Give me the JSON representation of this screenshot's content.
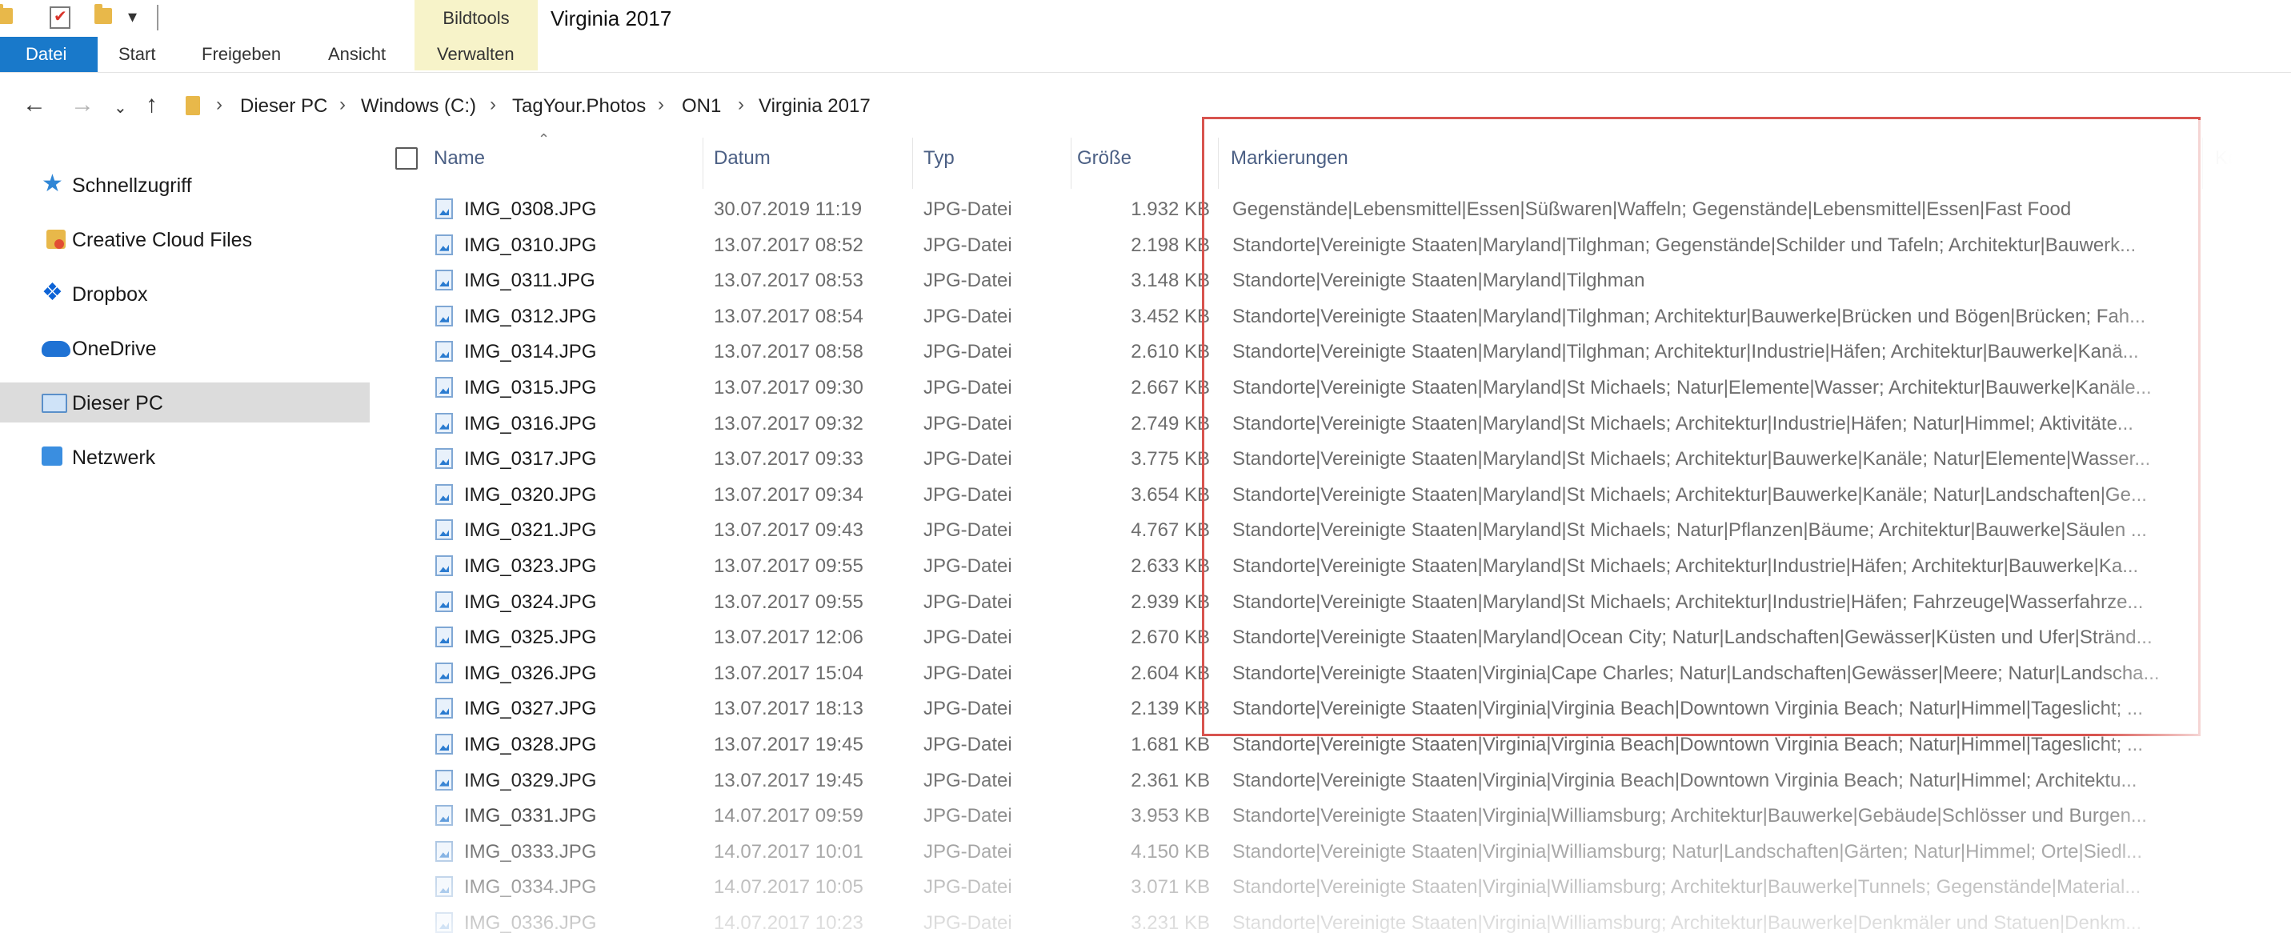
{
  "title_bar": {
    "context_tab": "Bildtools",
    "window_title": "Virginia 2017"
  },
  "ribbon": {
    "tabs": [
      "Datei",
      "Start",
      "Freigeben",
      "Ansicht",
      "Verwalten"
    ]
  },
  "address_bar": {
    "breadcrumbs": [
      "Dieser PC",
      "Windows (C:)",
      "TagYour.Photos",
      "ON1",
      "Virginia 2017"
    ]
  },
  "sidebar": {
    "items": [
      {
        "label": "Schnellzugriff",
        "icon": "star-icon"
      },
      {
        "label": "Creative Cloud Files",
        "icon": "creative-cloud-folder-icon"
      },
      {
        "label": "Dropbox",
        "icon": "dropbox-icon"
      },
      {
        "label": "OneDrive",
        "icon": "onedrive-cloud-icon"
      },
      {
        "label": "Dieser PC",
        "icon": "pc-icon",
        "selected": true
      },
      {
        "label": "Netzwerk",
        "icon": "network-icon"
      }
    ]
  },
  "columns": {
    "name": "Name",
    "date": "Datum",
    "type": "Typ",
    "size": "Größe",
    "tags": "Markierungen",
    "extra": "Kontakt"
  },
  "highlight_color": "#d8544f",
  "files": [
    {
      "name": "IMG_0308.JPG",
      "date": "30.07.2019 11:19",
      "type": "JPG-Datei",
      "size": "1.932 KB",
      "tags": "Gegenstände|Lebensmittel|Essen|Süßwaren|Waffeln; Gegenstände|Lebensmittel|Essen|Fast Food"
    },
    {
      "name": "IMG_0310.JPG",
      "date": "13.07.2017 08:52",
      "type": "JPG-Datei",
      "size": "2.198 KB",
      "tags": "Standorte|Vereinigte Staaten|Maryland|Tilghman; Gegenstände|Schilder und Tafeln; Architektur|Bauwerk..."
    },
    {
      "name": "IMG_0311.JPG",
      "date": "13.07.2017 08:53",
      "type": "JPG-Datei",
      "size": "3.148 KB",
      "tags": "Standorte|Vereinigte Staaten|Maryland|Tilghman"
    },
    {
      "name": "IMG_0312.JPG",
      "date": "13.07.2017 08:54",
      "type": "JPG-Datei",
      "size": "3.452 KB",
      "tags": "Standorte|Vereinigte Staaten|Maryland|Tilghman; Architektur|Bauwerke|Brücken und Bögen|Brücken; Fah..."
    },
    {
      "name": "IMG_0314.JPG",
      "date": "13.07.2017 08:58",
      "type": "JPG-Datei",
      "size": "2.610 KB",
      "tags": "Standorte|Vereinigte Staaten|Maryland|Tilghman; Architektur|Industrie|Häfen; Architektur|Bauwerke|Kanä..."
    },
    {
      "name": "IMG_0315.JPG",
      "date": "13.07.2017 09:30",
      "type": "JPG-Datei",
      "size": "2.667 KB",
      "tags": "Standorte|Vereinigte Staaten|Maryland|St Michaels; Natur|Elemente|Wasser; Architektur|Bauwerke|Kanäle..."
    },
    {
      "name": "IMG_0316.JPG",
      "date": "13.07.2017 09:32",
      "type": "JPG-Datei",
      "size": "2.749 KB",
      "tags": "Standorte|Vereinigte Staaten|Maryland|St Michaels; Architektur|Industrie|Häfen; Natur|Himmel; Aktivitäte..."
    },
    {
      "name": "IMG_0317.JPG",
      "date": "13.07.2017 09:33",
      "type": "JPG-Datei",
      "size": "3.775 KB",
      "tags": "Standorte|Vereinigte Staaten|Maryland|St Michaels; Architektur|Bauwerke|Kanäle; Natur|Elemente|Wasser..."
    },
    {
      "name": "IMG_0320.JPG",
      "date": "13.07.2017 09:34",
      "type": "JPG-Datei",
      "size": "3.654 KB",
      "tags": "Standorte|Vereinigte Staaten|Maryland|St Michaels; Architektur|Bauwerke|Kanäle; Natur|Landschaften|Ge..."
    },
    {
      "name": "IMG_0321.JPG",
      "date": "13.07.2017 09:43",
      "type": "JPG-Datei",
      "size": "4.767 KB",
      "tags": "Standorte|Vereinigte Staaten|Maryland|St Michaels; Natur|Pflanzen|Bäume; Architektur|Bauwerke|Säulen ..."
    },
    {
      "name": "IMG_0323.JPG",
      "date": "13.07.2017 09:55",
      "type": "JPG-Datei",
      "size": "2.633 KB",
      "tags": "Standorte|Vereinigte Staaten|Maryland|St Michaels; Architektur|Industrie|Häfen; Architektur|Bauwerke|Ka..."
    },
    {
      "name": "IMG_0324.JPG",
      "date": "13.07.2017 09:55",
      "type": "JPG-Datei",
      "size": "2.939 KB",
      "tags": "Standorte|Vereinigte Staaten|Maryland|St Michaels; Architektur|Industrie|Häfen; Fahrzeuge|Wasserfahrze..."
    },
    {
      "name": "IMG_0325.JPG",
      "date": "13.07.2017 12:06",
      "type": "JPG-Datei",
      "size": "2.670 KB",
      "tags": "Standorte|Vereinigte Staaten|Maryland|Ocean City; Natur|Landschaften|Gewässer|Küsten und Ufer|Stränd..."
    },
    {
      "name": "IMG_0326.JPG",
      "date": "13.07.2017 15:04",
      "type": "JPG-Datei",
      "size": "2.604 KB",
      "tags": "Standorte|Vereinigte Staaten|Virginia|Cape Charles; Natur|Landschaften|Gewässer|Meere; Natur|Landscha..."
    },
    {
      "name": "IMG_0327.JPG",
      "date": "13.07.2017 18:13",
      "type": "JPG-Datei",
      "size": "2.139 KB",
      "tags": "Standorte|Vereinigte Staaten|Virginia|Virginia Beach|Downtown Virginia Beach; Natur|Himmel|Tageslicht; ..."
    },
    {
      "name": "IMG_0328.JPG",
      "date": "13.07.2017 19:45",
      "type": "JPG-Datei",
      "size": "1.681 KB",
      "tags": "Standorte|Vereinigte Staaten|Virginia|Virginia Beach|Downtown Virginia Beach; Natur|Himmel|Tageslicht; ..."
    },
    {
      "name": "IMG_0329.JPG",
      "date": "13.07.2017 19:45",
      "type": "JPG-Datei",
      "size": "2.361 KB",
      "tags": "Standorte|Vereinigte Staaten|Virginia|Virginia Beach|Downtown Virginia Beach; Natur|Himmel; Architektu..."
    },
    {
      "name": "IMG_0331.JPG",
      "date": "14.07.2017 09:59",
      "type": "JPG-Datei",
      "size": "3.953 KB",
      "tags": "Standorte|Vereinigte Staaten|Virginia|Williamsburg; Architektur|Bauwerke|Gebäude|Schlösser und Burgen..."
    },
    {
      "name": "IMG_0333.JPG",
      "date": "14.07.2017 10:01",
      "type": "JPG-Datei",
      "size": "4.150 KB",
      "tags": "Standorte|Vereinigte Staaten|Virginia|Williamsburg; Natur|Landschaften|Gärten; Natur|Himmel; Orte|Siedl..."
    },
    {
      "name": "IMG_0334.JPG",
      "date": "14.07.2017 10:05",
      "type": "JPG-Datei",
      "size": "3.071 KB",
      "tags": "Standorte|Vereinigte Staaten|Virginia|Williamsburg; Architektur|Bauwerke|Tunnels; Gegenstände|Material..."
    },
    {
      "name": "IMG_0336.JPG",
      "date": "14.07.2017 10:23",
      "type": "JPG-Datei",
      "size": "3.231 KB",
      "tags": "Standorte|Vereinigte Staaten|Virginia|Williamsburg; Architektur|Bauwerke|Denkmäler und Statuen|Denkm..."
    }
  ]
}
